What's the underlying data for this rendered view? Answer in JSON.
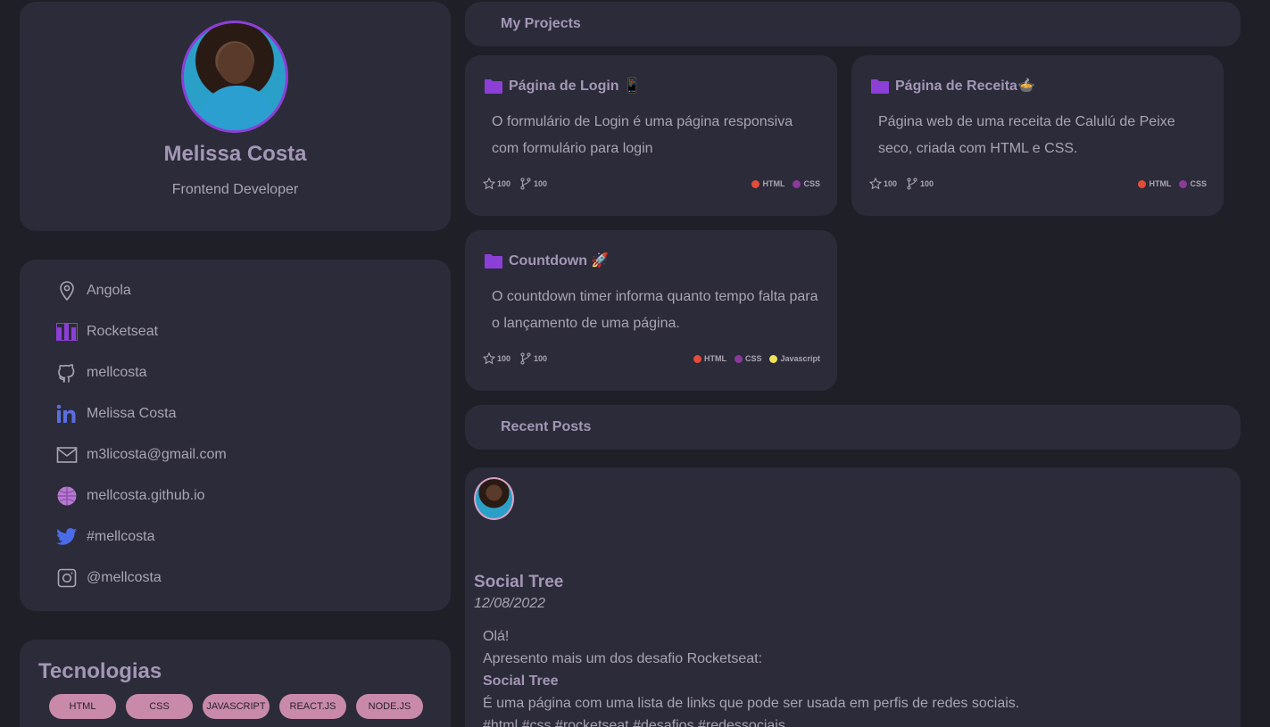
{
  "profile": {
    "name": "Melissa Costa",
    "role": "Frontend Developer"
  },
  "contacts": [
    {
      "icon": "location-pin-icon",
      "text": "Angola"
    },
    {
      "icon": "rocketseat-icon",
      "text": "Rocketseat"
    },
    {
      "icon": "github-icon",
      "text": "mellcosta"
    },
    {
      "icon": "linkedin-icon",
      "text": "Melissa Costa"
    },
    {
      "icon": "mail-icon",
      "text": "m3licosta@gmail.com"
    },
    {
      "icon": "globe-icon",
      "text": "mellcosta.github.io"
    },
    {
      "icon": "twitter-icon",
      "text": "#mellcosta"
    },
    {
      "icon": "instagram-icon",
      "text": "@mellcosta"
    }
  ],
  "tech": {
    "title": "Tecnologias",
    "tags": [
      "HTML",
      "CSS",
      "JAVASCRIPT",
      "REACT.JS",
      "NODE.JS"
    ]
  },
  "projects_header": "My Projects",
  "projects": [
    {
      "title": "Página de Login 📱",
      "description": "O formulário de Login é uma página responsiva com formulário para login",
      "stars": "100",
      "forks": "100",
      "langs": [
        {
          "name": "HTML",
          "color": "#e34c3a"
        },
        {
          "name": "CSS",
          "color": "#8a3a9a"
        }
      ]
    },
    {
      "title": "Página de Receita🍲",
      "description": "Página web de uma receita de Calulú de Peixe seco, criada com HTML e CSS.",
      "stars": "100",
      "forks": "100",
      "langs": [
        {
          "name": "HTML",
          "color": "#e34c3a"
        },
        {
          "name": "CSS",
          "color": "#8a3a9a"
        }
      ]
    },
    {
      "title": "Countdown 🚀",
      "description": "O countdown timer informa quanto tempo falta para o lançamento de uma página.",
      "stars": "100",
      "forks": "100",
      "langs": [
        {
          "name": "HTML",
          "color": "#e34c3a"
        },
        {
          "name": "CSS",
          "color": "#8a3a9a"
        },
        {
          "name": "Javascript",
          "color": "#f1e05a"
        }
      ]
    }
  ],
  "posts_header": "Recent Posts",
  "post": {
    "title": "Social Tree",
    "date": "12/08/2022",
    "line1": "Olá!",
    "line2": "Apresento mais um dos desafio Rocketseat:",
    "line3": "Social Tree",
    "line4": "É uma página com uma lista de links que pode ser usada em perfis de redes sociais.",
    "line5": "#html #css #rocketseat #desafios #redessociais"
  },
  "colors": {
    "background": "#1f1f28",
    "card": "#2c2b39",
    "accent": "#8b3fd6",
    "tag": "#c98aa9"
  }
}
